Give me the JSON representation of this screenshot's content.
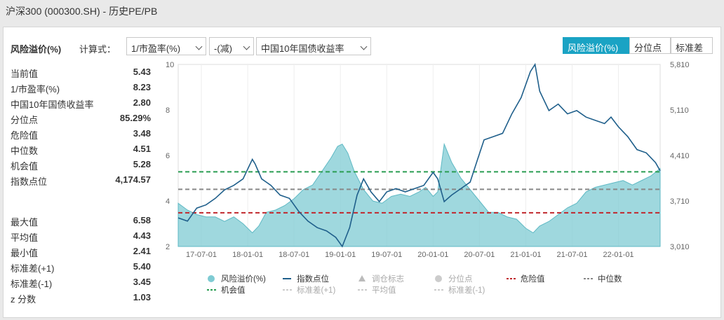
{
  "header": {
    "title": "沪深300 (000300.SH) - 历史PE/PB"
  },
  "toolbar": {
    "section_label": "风险溢价(%)",
    "formula_label": "计算式：",
    "select_left": "1/市盈率(%)",
    "select_op": "-(减)",
    "select_right": "中国10年国债收益率",
    "seg_premium": "风险溢价(%)",
    "seg_quantile": "分位点",
    "seg_std": "标准差"
  },
  "stats_top": [
    {
      "k": "当前值",
      "v": "5.43"
    },
    {
      "k": "1/市盈率(%)",
      "v": "8.23"
    },
    {
      "k": "中国10年国债收益率",
      "v": "2.80"
    },
    {
      "k": "分位点",
      "v": "85.29%"
    },
    {
      "k": "危险值",
      "v": "3.48"
    },
    {
      "k": "中位数",
      "v": "4.51"
    },
    {
      "k": "机会值",
      "v": "5.28"
    },
    {
      "k": "指数点位",
      "v": "4,174.57"
    }
  ],
  "stats_bottom": [
    {
      "k": "最大值",
      "v": "6.58"
    },
    {
      "k": "平均值",
      "v": "4.43"
    },
    {
      "k": "最小值",
      "v": "2.41"
    },
    {
      "k": "标准差(+1)",
      "v": "5.40"
    },
    {
      "k": "标准差(-1)",
      "v": "3.45"
    },
    {
      "k": "z 分数",
      "v": "1.03"
    }
  ],
  "chart_data": {
    "type": "line",
    "x_ticks": [
      "17-07-01",
      "18-01-01",
      "18-07-01",
      "19-01-01",
      "19-07-01",
      "20-01-01",
      "20-07-01",
      "21-01-01",
      "21-07-01",
      "22-01-01"
    ],
    "y_left_ticks": [
      "2",
      "4",
      "6",
      "8",
      "10"
    ],
    "y_left_range": [
      2,
      10
    ],
    "y_right_ticks": [
      "3,010",
      "3,710",
      "4,410",
      "5,110",
      "5,810"
    ],
    "y_right_range": [
      3010,
      5810
    ],
    "x_range": [
      2017.25,
      2022.45
    ],
    "grid": "vertical",
    "series": [
      {
        "name": "风险溢价(%)",
        "kind": "area",
        "color": "#7fcbd3",
        "points": [
          [
            2017.25,
            3.9
          ],
          [
            2017.35,
            3.6
          ],
          [
            2017.45,
            3.4
          ],
          [
            2017.55,
            3.3
          ],
          [
            2017.65,
            3.3
          ],
          [
            2017.75,
            3.1
          ],
          [
            2017.85,
            3.3
          ],
          [
            2017.95,
            3.0
          ],
          [
            2018.05,
            2.6
          ],
          [
            2018.12,
            2.9
          ],
          [
            2018.2,
            3.5
          ],
          [
            2018.3,
            3.6
          ],
          [
            2018.4,
            3.8
          ],
          [
            2018.5,
            4.1
          ],
          [
            2018.6,
            4.5
          ],
          [
            2018.7,
            4.7
          ],
          [
            2018.8,
            5.3
          ],
          [
            2018.9,
            5.9
          ],
          [
            2018.97,
            6.4
          ],
          [
            2019.02,
            6.5
          ],
          [
            2019.08,
            6.1
          ],
          [
            2019.15,
            5.3
          ],
          [
            2019.25,
            4.5
          ],
          [
            2019.35,
            4.0
          ],
          [
            2019.45,
            3.9
          ],
          [
            2019.55,
            4.2
          ],
          [
            2019.65,
            4.3
          ],
          [
            2019.75,
            4.2
          ],
          [
            2019.85,
            4.4
          ],
          [
            2019.92,
            4.6
          ],
          [
            2020.0,
            4.2
          ],
          [
            2020.05,
            4.4
          ],
          [
            2020.12,
            6.5
          ],
          [
            2020.2,
            5.7
          ],
          [
            2020.3,
            5.0
          ],
          [
            2020.4,
            4.5
          ],
          [
            2020.5,
            4.0
          ],
          [
            2020.6,
            3.5
          ],
          [
            2020.7,
            3.5
          ],
          [
            2020.8,
            3.3
          ],
          [
            2020.9,
            3.2
          ],
          [
            2021.0,
            2.8
          ],
          [
            2021.08,
            2.6
          ],
          [
            2021.15,
            2.9
          ],
          [
            2021.25,
            3.1
          ],
          [
            2021.35,
            3.4
          ],
          [
            2021.45,
            3.7
          ],
          [
            2021.55,
            3.9
          ],
          [
            2021.65,
            4.4
          ],
          [
            2021.75,
            4.6
          ],
          [
            2021.85,
            4.7
          ],
          [
            2021.95,
            4.8
          ],
          [
            2022.05,
            4.9
          ],
          [
            2022.15,
            4.7
          ],
          [
            2022.25,
            4.9
          ],
          [
            2022.35,
            5.1
          ],
          [
            2022.45,
            5.43
          ]
        ]
      },
      {
        "name": "指数点位",
        "kind": "line",
        "axis": "right",
        "color": "#1f5f8b",
        "points": [
          [
            2017.25,
            3450
          ],
          [
            2017.35,
            3400
          ],
          [
            2017.45,
            3600
          ],
          [
            2017.55,
            3650
          ],
          [
            2017.65,
            3750
          ],
          [
            2017.75,
            3880
          ],
          [
            2017.85,
            3950
          ],
          [
            2017.95,
            4050
          ],
          [
            2018.05,
            4350
          ],
          [
            2018.08,
            4280
          ],
          [
            2018.15,
            4050
          ],
          [
            2018.25,
            3950
          ],
          [
            2018.35,
            3800
          ],
          [
            2018.45,
            3750
          ],
          [
            2018.55,
            3550
          ],
          [
            2018.65,
            3400
          ],
          [
            2018.75,
            3300
          ],
          [
            2018.85,
            3250
          ],
          [
            2018.95,
            3150
          ],
          [
            2019.02,
            3010
          ],
          [
            2019.1,
            3300
          ],
          [
            2019.18,
            3800
          ],
          [
            2019.25,
            4050
          ],
          [
            2019.33,
            3850
          ],
          [
            2019.42,
            3700
          ],
          [
            2019.5,
            3850
          ],
          [
            2019.6,
            3900
          ],
          [
            2019.7,
            3850
          ],
          [
            2019.8,
            3900
          ],
          [
            2019.9,
            3950
          ],
          [
            2020.0,
            4150
          ],
          [
            2020.05,
            4050
          ],
          [
            2020.12,
            3700
          ],
          [
            2020.2,
            3800
          ],
          [
            2020.3,
            3900
          ],
          [
            2020.4,
            4000
          ],
          [
            2020.48,
            4350
          ],
          [
            2020.55,
            4650
          ],
          [
            2020.65,
            4700
          ],
          [
            2020.75,
            4750
          ],
          [
            2020.85,
            5050
          ],
          [
            2020.95,
            5300
          ],
          [
            2021.05,
            5700
          ],
          [
            2021.1,
            5810
          ],
          [
            2021.15,
            5400
          ],
          [
            2021.25,
            5100
          ],
          [
            2021.35,
            5200
          ],
          [
            2021.45,
            5050
          ],
          [
            2021.55,
            5100
          ],
          [
            2021.65,
            5000
          ],
          [
            2021.75,
            4950
          ],
          [
            2021.85,
            4900
          ],
          [
            2021.92,
            5000
          ],
          [
            2022.0,
            4850
          ],
          [
            2022.1,
            4700
          ],
          [
            2022.2,
            4500
          ],
          [
            2022.3,
            4450
          ],
          [
            2022.4,
            4300
          ],
          [
            2022.45,
            4174.57
          ]
        ]
      }
    ],
    "ref_lines": [
      {
        "name": "机会值",
        "value": 5.28,
        "color": "#2a9d52"
      },
      {
        "name": "中位数",
        "value": 4.51,
        "color": "#888888"
      },
      {
        "name": "危险值",
        "value": 3.48,
        "color": "#c0272d"
      }
    ],
    "legend": [
      {
        "label": "风险溢价(%)",
        "icon": "circle",
        "color": "#7fcbd3",
        "dim": false
      },
      {
        "label": "指数点位",
        "icon": "line",
        "color": "#1f5f8b",
        "dim": false
      },
      {
        "label": "调仓标志",
        "icon": "triangle",
        "color": "#bbbbbb",
        "dim": true
      },
      {
        "label": "分位点",
        "icon": "circle",
        "color": "#cccccc",
        "dim": true
      },
      {
        "label": "危险值",
        "icon": "dash",
        "color": "#c0272d",
        "dim": false
      },
      {
        "label": "中位数",
        "icon": "dash",
        "color": "#888888",
        "dim": false
      },
      {
        "label": "机会值",
        "icon": "dash",
        "color": "#2a9d52",
        "dim": false
      },
      {
        "label": "标准差(+1)",
        "icon": "dash",
        "color": "#cccccc",
        "dim": true
      },
      {
        "label": "平均值",
        "icon": "dash",
        "color": "#cccccc",
        "dim": true
      },
      {
        "label": "标准差(-1)",
        "icon": "dash",
        "color": "#cccccc",
        "dim": true
      }
    ]
  }
}
